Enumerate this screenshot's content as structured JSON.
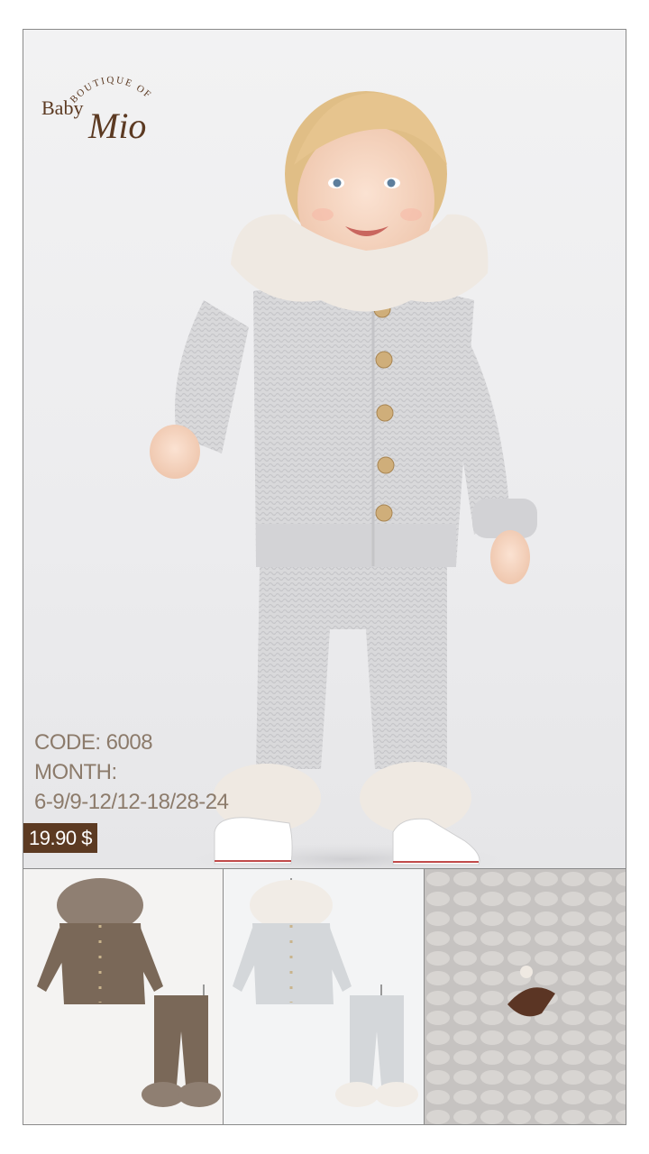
{
  "brand": {
    "arc_text": "BOUTIQUE OF",
    "name_part1": "Baby",
    "name_part2": "Mio",
    "color": "#5c3a22"
  },
  "product": {
    "code_line": "CODE: 6008",
    "month_label": "MONTH:",
    "sizes": "6-9/9-12/12-18/28-24",
    "price": "19.90 $"
  },
  "colors": {
    "text": "#8c7b6b",
    "price_bg": "#5c3a22",
    "knit_grey": "#d6d6d8",
    "knit_brown": "#7a6858",
    "fur": "#efe9e2"
  },
  "images": {
    "hero": "baby-in-grey-knit-set",
    "thumb1": "brown-knit-set-on-hanger",
    "thumb2": "grey-knit-set-on-hanger",
    "thumb3": "knit-texture-closeup"
  }
}
